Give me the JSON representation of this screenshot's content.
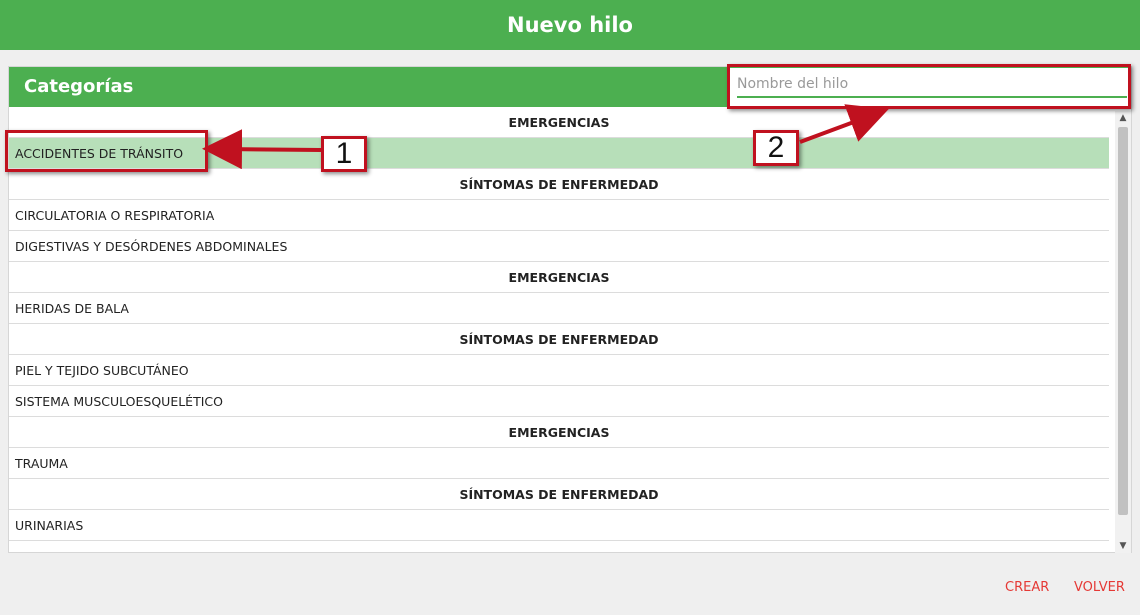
{
  "topbar": {
    "title": "Nuevo hilo"
  },
  "panel": {
    "title": "Categorías",
    "search_placeholder": "Nombre del hilo"
  },
  "list": [
    {
      "type": "header",
      "label": "EMERGENCIAS"
    },
    {
      "type": "item",
      "label": "ACCIDENTES DE TRÁNSITO",
      "selected": true
    },
    {
      "type": "header",
      "label": "SÍNTOMAS DE ENFERMEDAD"
    },
    {
      "type": "item",
      "label": "CIRCULATORIA O RESPIRATORIA"
    },
    {
      "type": "item",
      "label": "DIGESTIVAS Y DESÓRDENES ABDOMINALES"
    },
    {
      "type": "header",
      "label": "EMERGENCIAS"
    },
    {
      "type": "item",
      "label": "HERIDAS DE BALA"
    },
    {
      "type": "header",
      "label": "SÍNTOMAS DE ENFERMEDAD"
    },
    {
      "type": "item",
      "label": "PIEL Y TEJIDO SUBCUTÁNEO"
    },
    {
      "type": "item",
      "label": "SISTEMA MUSCULOESQUELÉTICO"
    },
    {
      "type": "header",
      "label": "EMERGENCIAS"
    },
    {
      "type": "item",
      "label": "TRAUMA"
    },
    {
      "type": "header",
      "label": "SÍNTOMAS DE ENFERMEDAD"
    },
    {
      "type": "item",
      "label": "URINARIAS"
    }
  ],
  "annotations": {
    "label_1": "1",
    "label_2": "2"
  },
  "footer": {
    "create_label": "CREAR",
    "back_label": "VOLVER"
  },
  "colors": {
    "primary": "#4caf50",
    "selected_row": "#b7dfb9",
    "annotation": "#c0111f",
    "footer_buttons": "#e53935"
  }
}
